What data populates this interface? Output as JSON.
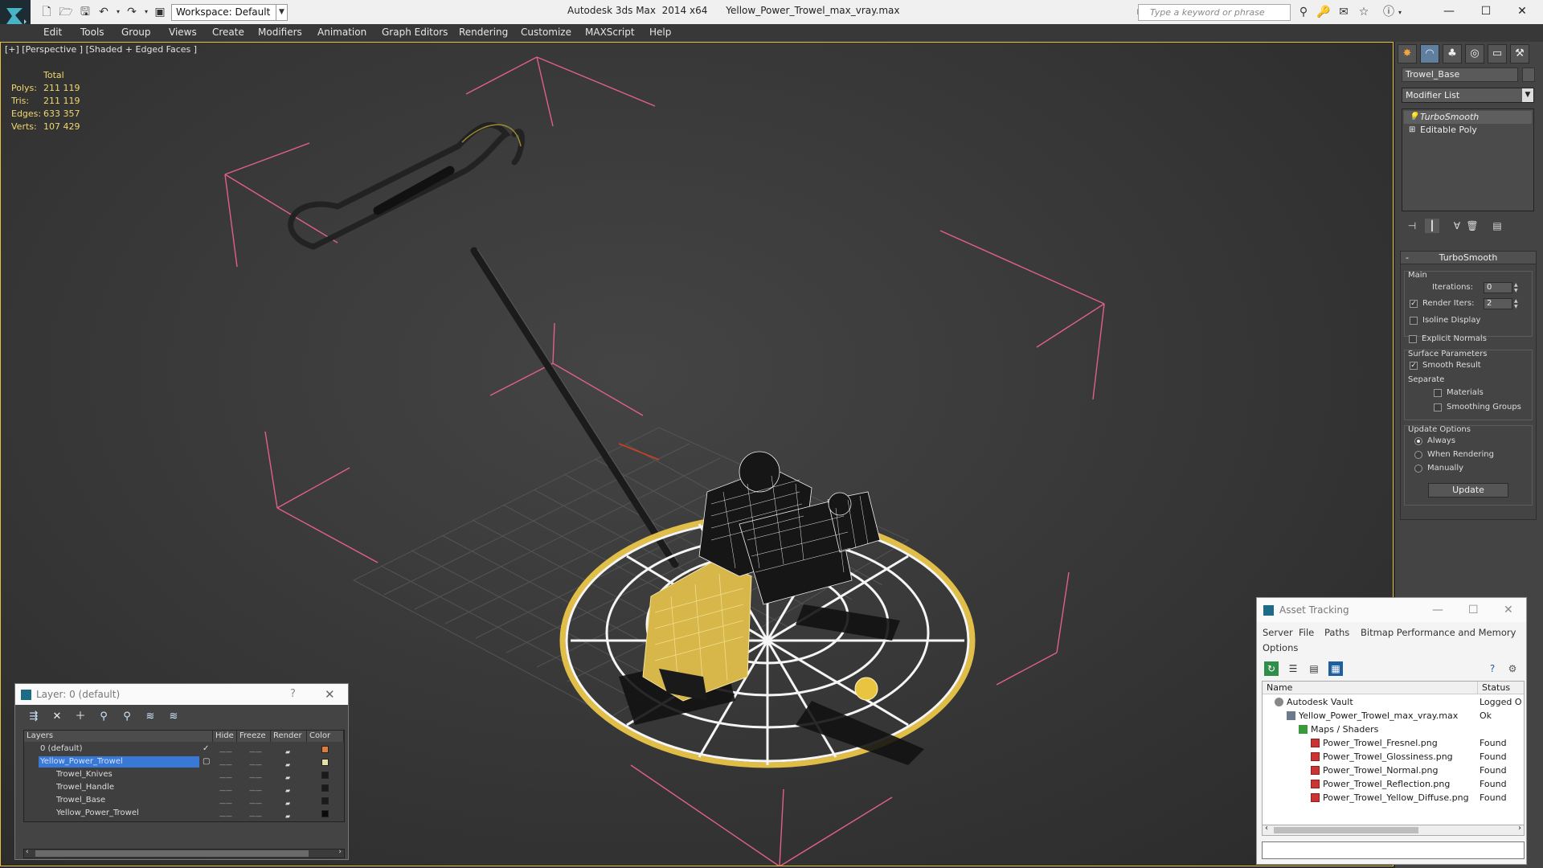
{
  "window": {
    "app_title": "Autodesk 3ds Max  2014 x64",
    "file_title": "Yellow_Power_Trowel_max_vray.max",
    "workspace_label": "Workspace: Default",
    "search_placeholder": "Type a keyword or phrase"
  },
  "menu": [
    "Edit",
    "Tools",
    "Group",
    "Views",
    "Create",
    "Modifiers",
    "Animation",
    "Graph Editors",
    "Rendering",
    "Customize",
    "MAXScript",
    "Help"
  ],
  "viewport": {
    "label": "[+] [Perspective ] [Shaded + Edged Faces ]",
    "stats_header": "Total",
    "stats": [
      {
        "label": "Polys:",
        "value": "211 119"
      },
      {
        "label": "Tris:",
        "value": "211 119"
      },
      {
        "label": "Edges:",
        "value": "633 357"
      },
      {
        "label": "Verts:",
        "value": "107 429"
      }
    ]
  },
  "command_panel": {
    "object_name": "Trowel_Base",
    "modifier_list": "Modifier List",
    "stack": [
      "TurboSmooth",
      "Editable Poly"
    ],
    "rollout_title": "TurboSmooth",
    "main_group": "Main",
    "iterations_label": "Iterations:",
    "iterations_value": "0",
    "render_iters_label": "Render Iters:",
    "render_iters_value": "2",
    "isoline_label": "Isoline Display",
    "explicit_normals_label": "Explicit Normals",
    "surface_group": "Surface Parameters",
    "smooth_result_label": "Smooth Result",
    "separate_label": "Separate",
    "materials_label": "Materials",
    "smoothing_groups_label": "Smoothing Groups",
    "update_group": "Update Options",
    "always_label": "Always",
    "when_rendering_label": "When Rendering",
    "manually_label": "Manually",
    "update_button": "Update"
  },
  "layer_dialog": {
    "title": "Layer: 0 (default)",
    "help": "?",
    "columns": [
      "Layers",
      "Hide",
      "Freeze",
      "Render",
      "Color"
    ],
    "rows": [
      {
        "name": "0 (default)",
        "swatch": "#e07b3a"
      },
      {
        "name": "Yellow_Power_Trowel",
        "swatch": "#e6e0a8"
      },
      {
        "name": "Trowel_Knives",
        "swatch": "#1a1a1a"
      },
      {
        "name": "Trowel_Handle",
        "swatch": "#1a1a1a"
      },
      {
        "name": "Trowel_Base",
        "swatch": "#1a1a1a"
      },
      {
        "name": "Yellow_Power_Trowel",
        "swatch": "#0a0a0a"
      }
    ]
  },
  "asset_dialog": {
    "title": "Asset Tracking",
    "menu": [
      "Server",
      "File",
      "Paths",
      "Bitmap Performance and Memory",
      "Options"
    ],
    "columns": [
      "Name",
      "Status"
    ],
    "rows": [
      {
        "name": "Autodesk Vault",
        "status": "Logged O"
      },
      {
        "name": "Yellow_Power_Trowel_max_vray.max",
        "status": "Ok"
      },
      {
        "name": "Maps / Shaders",
        "status": ""
      },
      {
        "name": "Power_Trowel_Fresnel.png",
        "status": "Found"
      },
      {
        "name": "Power_Trowel_Glossiness.png",
        "status": "Found"
      },
      {
        "name": "Power_Trowel_Normal.png",
        "status": "Found"
      },
      {
        "name": "Power_Trowel_Reflection.png",
        "status": "Found"
      },
      {
        "name": "Power_Trowel_Yellow_Diffuse.png",
        "status": "Found"
      }
    ]
  }
}
